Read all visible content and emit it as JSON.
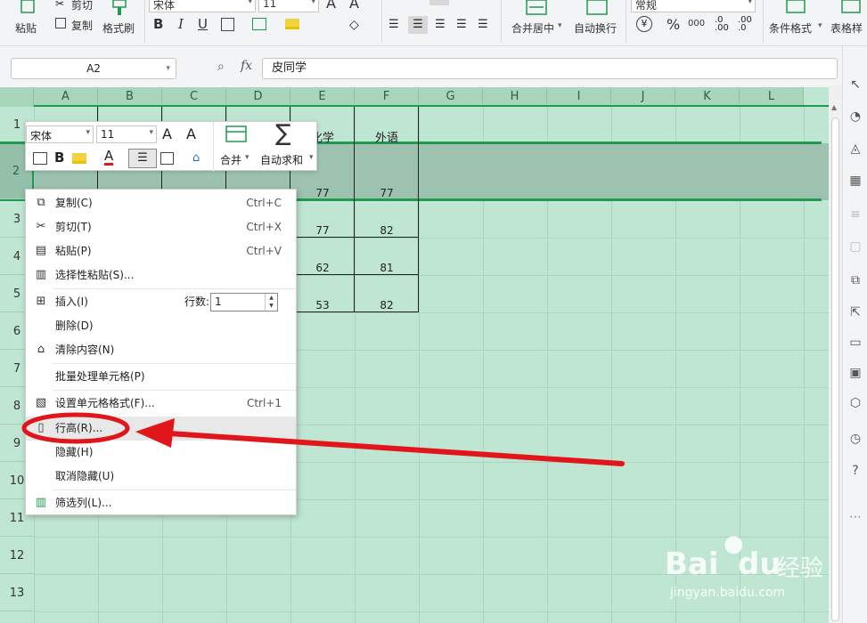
{
  "ribbon": {
    "paste": "粘贴",
    "cut": "剪切",
    "copy": "复制",
    "format_painter": "格式刷",
    "font_name": "宋体",
    "font_size": "11",
    "merge_center": "合并居中",
    "wrap_text": "自动换行",
    "number_format": "常规",
    "cond_format": "条件格式",
    "table_style": "表格样",
    "bold": "B",
    "italic": "I",
    "underline": "U",
    "percent": "%",
    "thousands": "000",
    "font_grow": "A",
    "font_shrink": "A"
  },
  "formula": {
    "cell_ref": "A2",
    "fx": "fx",
    "content": "皮同学"
  },
  "columns": [
    "A",
    "B",
    "C",
    "D",
    "E",
    "F",
    "G",
    "H",
    "I",
    "J",
    "K",
    "L"
  ],
  "rows": [
    "1",
    "2",
    "3",
    "4",
    "5",
    "6",
    "7",
    "8",
    "9",
    "10",
    "11",
    "12",
    "13"
  ],
  "cells": {
    "e1": "化学",
    "f1": "外语",
    "a2": "皮同学",
    "e2": "77",
    "f2": "77",
    "e3": "77",
    "f3": "82",
    "e4": "62",
    "f4": "81",
    "e5": "53",
    "f5": "82"
  },
  "mini_toolbar": {
    "font_name": "宋体",
    "font_size": "11",
    "merge": "合并",
    "autosum": "自动求和",
    "bold": "B",
    "grow": "A",
    "shrink": "A",
    "font_color": "A",
    "sum_glyph": "∑"
  },
  "context_menu": {
    "copy": "复制(C)",
    "copy_sc": "Ctrl+C",
    "cut": "剪切(T)",
    "cut_sc": "Ctrl+X",
    "paste": "粘贴(P)",
    "paste_sc": "Ctrl+V",
    "paste_special": "选择性粘贴(S)...",
    "insert": "插入(I)",
    "rows_label": "行数:",
    "rows_value": "1",
    "delete": "删除(D)",
    "clear": "清除内容(N)",
    "batch": "批量处理单元格(P)",
    "format_cells": "设置单元格格式(F)...",
    "format_sc": "Ctrl+1",
    "row_height": "行高(R)...",
    "hide": "隐藏(H)",
    "unhide": "取消隐藏(U)",
    "filter_col": "筛选列(L)..."
  },
  "watermark": {
    "brand": "Bai",
    "brand2": "du",
    "cn": "经验",
    "url": "jingyan.baidu.com"
  },
  "colors": {
    "sheet_bg": "#bfe6d2",
    "selection": "#9dc3b0",
    "accent_green": "#1f9a4f",
    "annotation_red": "#e0161b"
  }
}
